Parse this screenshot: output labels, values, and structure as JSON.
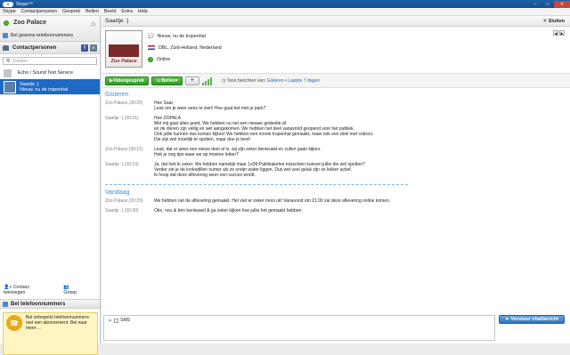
{
  "window": {
    "title": "Skype™",
    "logo": "skype"
  },
  "menu": [
    "Skype",
    "Contactpersonen",
    "Gesprek",
    "Bellen",
    "Beeld",
    "Extra",
    "Help"
  ],
  "sidebar": {
    "user_name": "Zoo Palace",
    "call_phones": "Bel gewone telefoonnummers",
    "contacts_header": "Contactpersonen",
    "search_placeholder": "Zoeken",
    "contacts": [
      {
        "name": "Echo / Sound Test Service",
        "mood": ""
      },
      {
        "name": "Saartje :)",
        "mood": "Nieuw, nu de tropenhal"
      }
    ],
    "add_contact": "Contact toevoegen",
    "group": "Groep",
    "phones_header": "Bel telefoonnummers",
    "promo": "Bel onbeperkt telefoonnummers met een abonnement. Bel naar meer ..."
  },
  "conversation": {
    "title": "Saartje :)",
    "close": "Sluiten",
    "mood": "Nieuw, nu de tropenhal",
    "location": "DBL, Zuid-Holland, Nederland",
    "status": "Online",
    "picture_label": "Zoo Palace",
    "video_btn": "Videogesprek",
    "call_btn": "Bellen",
    "history_label": "Toon berichten van:",
    "history_yesterday": "Gisteren",
    "history_7days": "Laatste 7 dagen"
  },
  "chat": {
    "day1": "Gisteren",
    "messages1": [
      {
        "who": "Zoo Palace (20:20)",
        "text": "Hee Saar,\nLeuk om je weer eens te zien! Hoe gaat het met je park?"
      },
      {
        "who": "Saartje :) (20:21)",
        "text": "Hee ZOPALA\nMet mij gaat alles goed. We hebben nu net een nieuwe gedeelte af\nen de dieren zijn veilig en wel aangekomen. We hebben het deel vanavond geopend voor het publiek.\nOok jullie kunnen dus komen kijken! We hebben een mooie tropenhal gemaakt, maar ook een deel met cobra's\nDie zijn wel moeilijk te spotten, maar doe je best!"
      },
      {
        "who": "Zoo Palace (20:21)",
        "text": "Leuk, dat er weer een nieuw deel af is, wij zijn zeker benieuwd en zullen gaan kijken.\nHeb je nog tips waar we op moeten letten?"
      },
      {
        "who": "Saartje :) (20:23)",
        "text": "Ja, dat heb ik zeker. We hebben namelijk maar 1x(M.Palmkakeloe misschien kunnen jullie die wel spotten?\nVerder zie je de krokodillen numer als ze onder water liggen. Dus wel veel geluk zijn ze lekker actief.\nIk hoop dat deze aflevering weer een succes wordt."
      }
    ],
    "day2": "Vandaag",
    "messages2": [
      {
        "who": "Zoo Palace (20:29)",
        "text": "We hebben net de aflevering gemaakt. Het ziet er  zeker mooi uit! Vanavond om 21:00 zal deze aflevering online komen."
      },
      {
        "who": "Saartje :) (20:30)",
        "text": "Oke, nou ik ben benieuwd & ga zeker kijken hoe jullie het gemaakt hebben."
      }
    ]
  },
  "compose": {
    "sms_label": "SMS",
    "send_btn": "Verstuur chatbericht"
  }
}
